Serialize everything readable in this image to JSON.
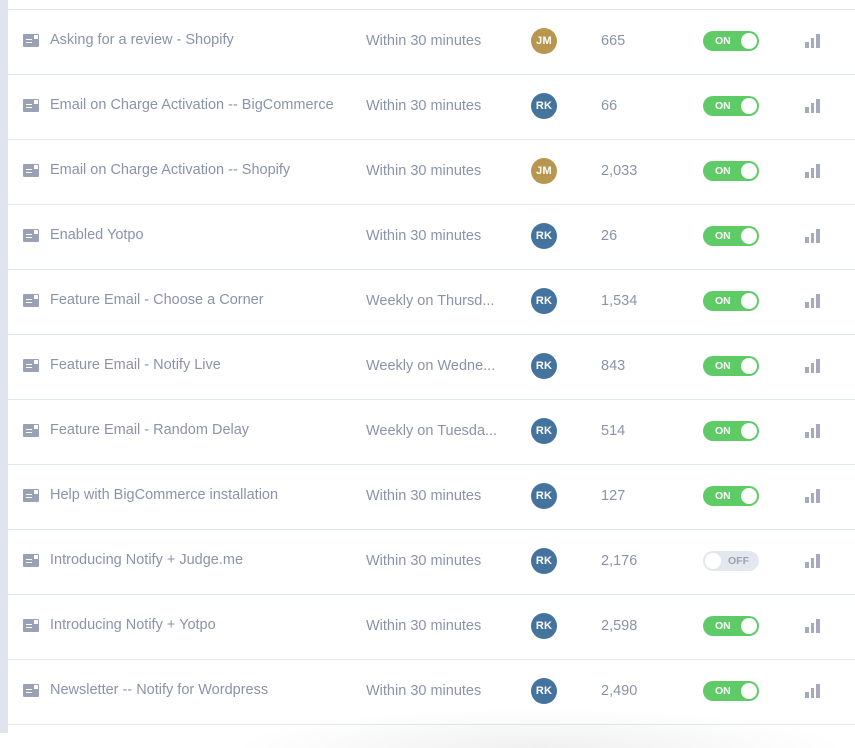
{
  "colors": {
    "toggle_on": "#5ecb67",
    "toggle_off": "#e3e8ef",
    "avatar_jm": "#b99650",
    "avatar_rk": "#44739e",
    "text": "#8a93a8",
    "divider": "#e3e8ef"
  },
  "table": {
    "rows": [
      {
        "icon": "message-icon",
        "name": "Asking for a review - Shopify",
        "schedule": "Within 30 minutes",
        "owner": "JM",
        "count": "665",
        "status": "ON",
        "enabled": true
      },
      {
        "icon": "message-icon",
        "name": "Email on Charge Activation -- BigCommerce",
        "schedule": "Within 30 minutes",
        "owner": "RK",
        "count": "66",
        "status": "ON",
        "enabled": true
      },
      {
        "icon": "message-icon",
        "name": "Email on Charge Activation -- Shopify",
        "schedule": "Within 30 minutes",
        "owner": "JM",
        "count": "2,033",
        "status": "ON",
        "enabled": true
      },
      {
        "icon": "message-icon",
        "name": "Enabled Yotpo",
        "schedule": "Within 30 minutes",
        "owner": "RK",
        "count": "26",
        "status": "ON",
        "enabled": true
      },
      {
        "icon": "message-icon",
        "name": "Feature Email - Choose a Corner",
        "schedule": "Weekly on Thursd...",
        "owner": "RK",
        "count": "1,534",
        "status": "ON",
        "enabled": true
      },
      {
        "icon": "message-icon",
        "name": "Feature Email - Notify Live",
        "schedule": "Weekly on Wedne...",
        "owner": "RK",
        "count": "843",
        "status": "ON",
        "enabled": true
      },
      {
        "icon": "message-icon",
        "name": "Feature Email - Random Delay",
        "schedule": "Weekly on Tuesda...",
        "owner": "RK",
        "count": "514",
        "status": "ON",
        "enabled": true
      },
      {
        "icon": "message-icon",
        "name": "Help with BigCommerce installation",
        "schedule": "Within 30 minutes",
        "owner": "RK",
        "count": "127",
        "status": "ON",
        "enabled": true
      },
      {
        "icon": "message-icon",
        "name": "Introducing Notify + Judge.me",
        "schedule": "Within 30 minutes",
        "owner": "RK",
        "count": "2,176",
        "status": "OFF",
        "enabled": false
      },
      {
        "icon": "message-icon",
        "name": "Introducing Notify + Yotpo",
        "schedule": "Within 30 minutes",
        "owner": "RK",
        "count": "2,598",
        "status": "ON",
        "enabled": true
      },
      {
        "icon": "message-icon",
        "name": "Newsletter -- Notify for Wordpress",
        "schedule": "Within 30 minutes",
        "owner": "RK",
        "count": "2,490",
        "status": "ON",
        "enabled": true
      }
    ],
    "stats_icon": "bar-chart-icon"
  }
}
